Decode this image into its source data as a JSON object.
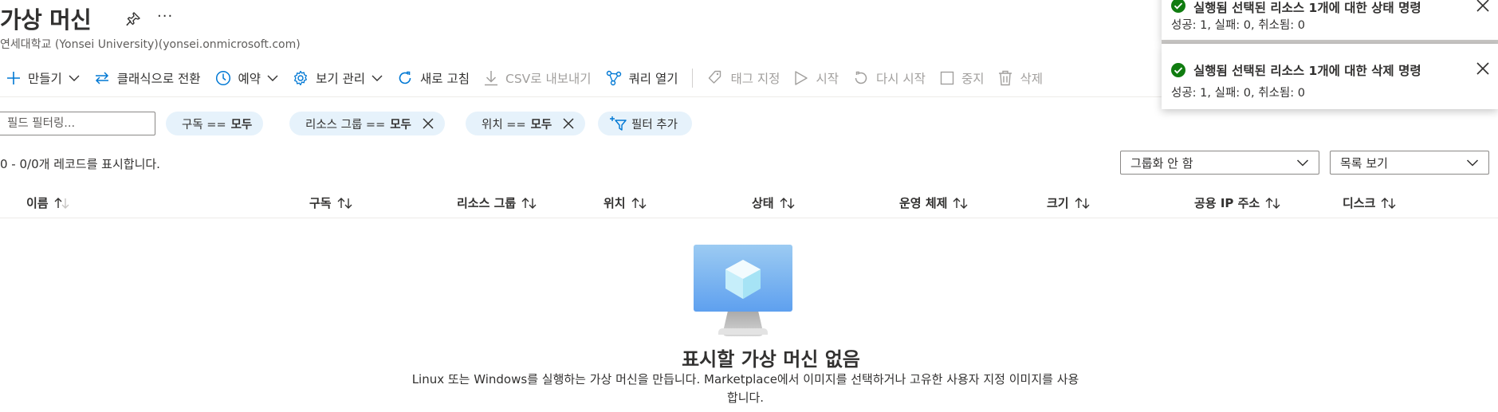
{
  "page": {
    "title": "가상 머신",
    "subtitle": "연세대학교 (Yonsei University)(yonsei.onmicrosoft.com)",
    "more_label": "···"
  },
  "toolbar": {
    "create": "만들기",
    "switch_classic": "클래식으로 전환",
    "reservations": "예약",
    "manage_view": "보기 관리",
    "refresh": "새로 고침",
    "export_csv": "CSV로 내보내기",
    "open_query": "쿼리 열기",
    "assign_tags": "태그 지정",
    "start": "시작",
    "restart": "다시 시작",
    "stop": "중지",
    "delete": "삭제"
  },
  "filters": {
    "placeholder": "필드 필터링...",
    "pills": [
      {
        "field": "구독 ==",
        "value": "모두"
      },
      {
        "field": "리소스 그룹 ==",
        "value": "모두"
      },
      {
        "field": "위치 ==",
        "value": "모두"
      }
    ],
    "add_filter": "필터 추가"
  },
  "records_text": "0 - 0/0개 레코드를 표시합니다.",
  "grouping": {
    "selected": "그룹화 안 함"
  },
  "view_mode": {
    "selected": "목록 보기"
  },
  "columns": [
    "이름",
    "구독",
    "리소스 그룹",
    "위치",
    "상태",
    "운영 체제",
    "크기",
    "공용 IP 주소",
    "디스크"
  ],
  "empty_state": {
    "title": "표시할 가상 머신 없음",
    "description": "Linux 또는 Windows를 실행하는 가상 머신을 만듭니다. Marketplace에서 이미지를 선택하거나 고유한 사용자 지정 이미지를 사용합니다."
  },
  "notifications": [
    {
      "title": "실행됨 선택된 리소스 1개에 대한 상태 명령",
      "body": "성공: 1, 실패: 0, 취소됨: 0"
    },
    {
      "title": "실행됨 선택된 리소스 1개에 대한 삭제 명령",
      "body": "성공: 1, 실패: 0, 취소됨: 0"
    }
  ],
  "colors": {
    "accent": "#0078d4",
    "success": "#107c10",
    "pill_bg": "#e6f2fb",
    "disabled": "#a19f9d"
  },
  "icons": [
    "pin-icon",
    "more-icon",
    "add-icon",
    "switch-icon",
    "clock-icon",
    "gear-icon",
    "refresh-icon",
    "download-icon",
    "query-icon",
    "tag-icon",
    "play-icon",
    "restart-icon",
    "stop-icon",
    "trash-icon",
    "close-icon",
    "filter-add-icon",
    "chevron-down-icon",
    "sort-icon",
    "vm-icon",
    "success-check-icon"
  ]
}
